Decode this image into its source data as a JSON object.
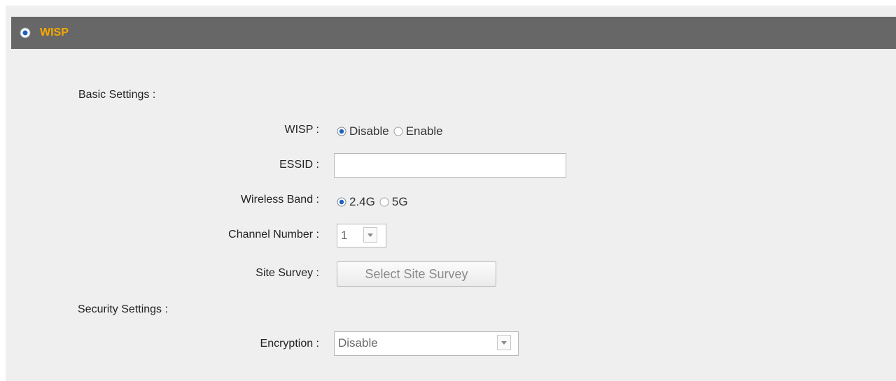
{
  "header": {
    "title": "WISP"
  },
  "sections": {
    "basic": "Basic Settings :",
    "security": "Security Settings :"
  },
  "fields": {
    "wisp": {
      "label": "WISP :",
      "options": [
        "Disable",
        "Enable"
      ],
      "selected": "Disable"
    },
    "essid": {
      "label": "ESSID :",
      "value": ""
    },
    "wireless_band": {
      "label": "Wireless Band :",
      "options": [
        "2.4G",
        "5G"
      ],
      "selected": "2.4G"
    },
    "channel_number": {
      "label": "Channel Number :",
      "value": "1"
    },
    "site_survey": {
      "label": "Site Survey :",
      "button": "Select Site Survey"
    },
    "encryption": {
      "label": "Encryption :",
      "value": "Disable"
    }
  },
  "colors": {
    "header_bg": "#676767",
    "header_title": "#f5a800",
    "radio_selected": "#1f5fbf"
  }
}
